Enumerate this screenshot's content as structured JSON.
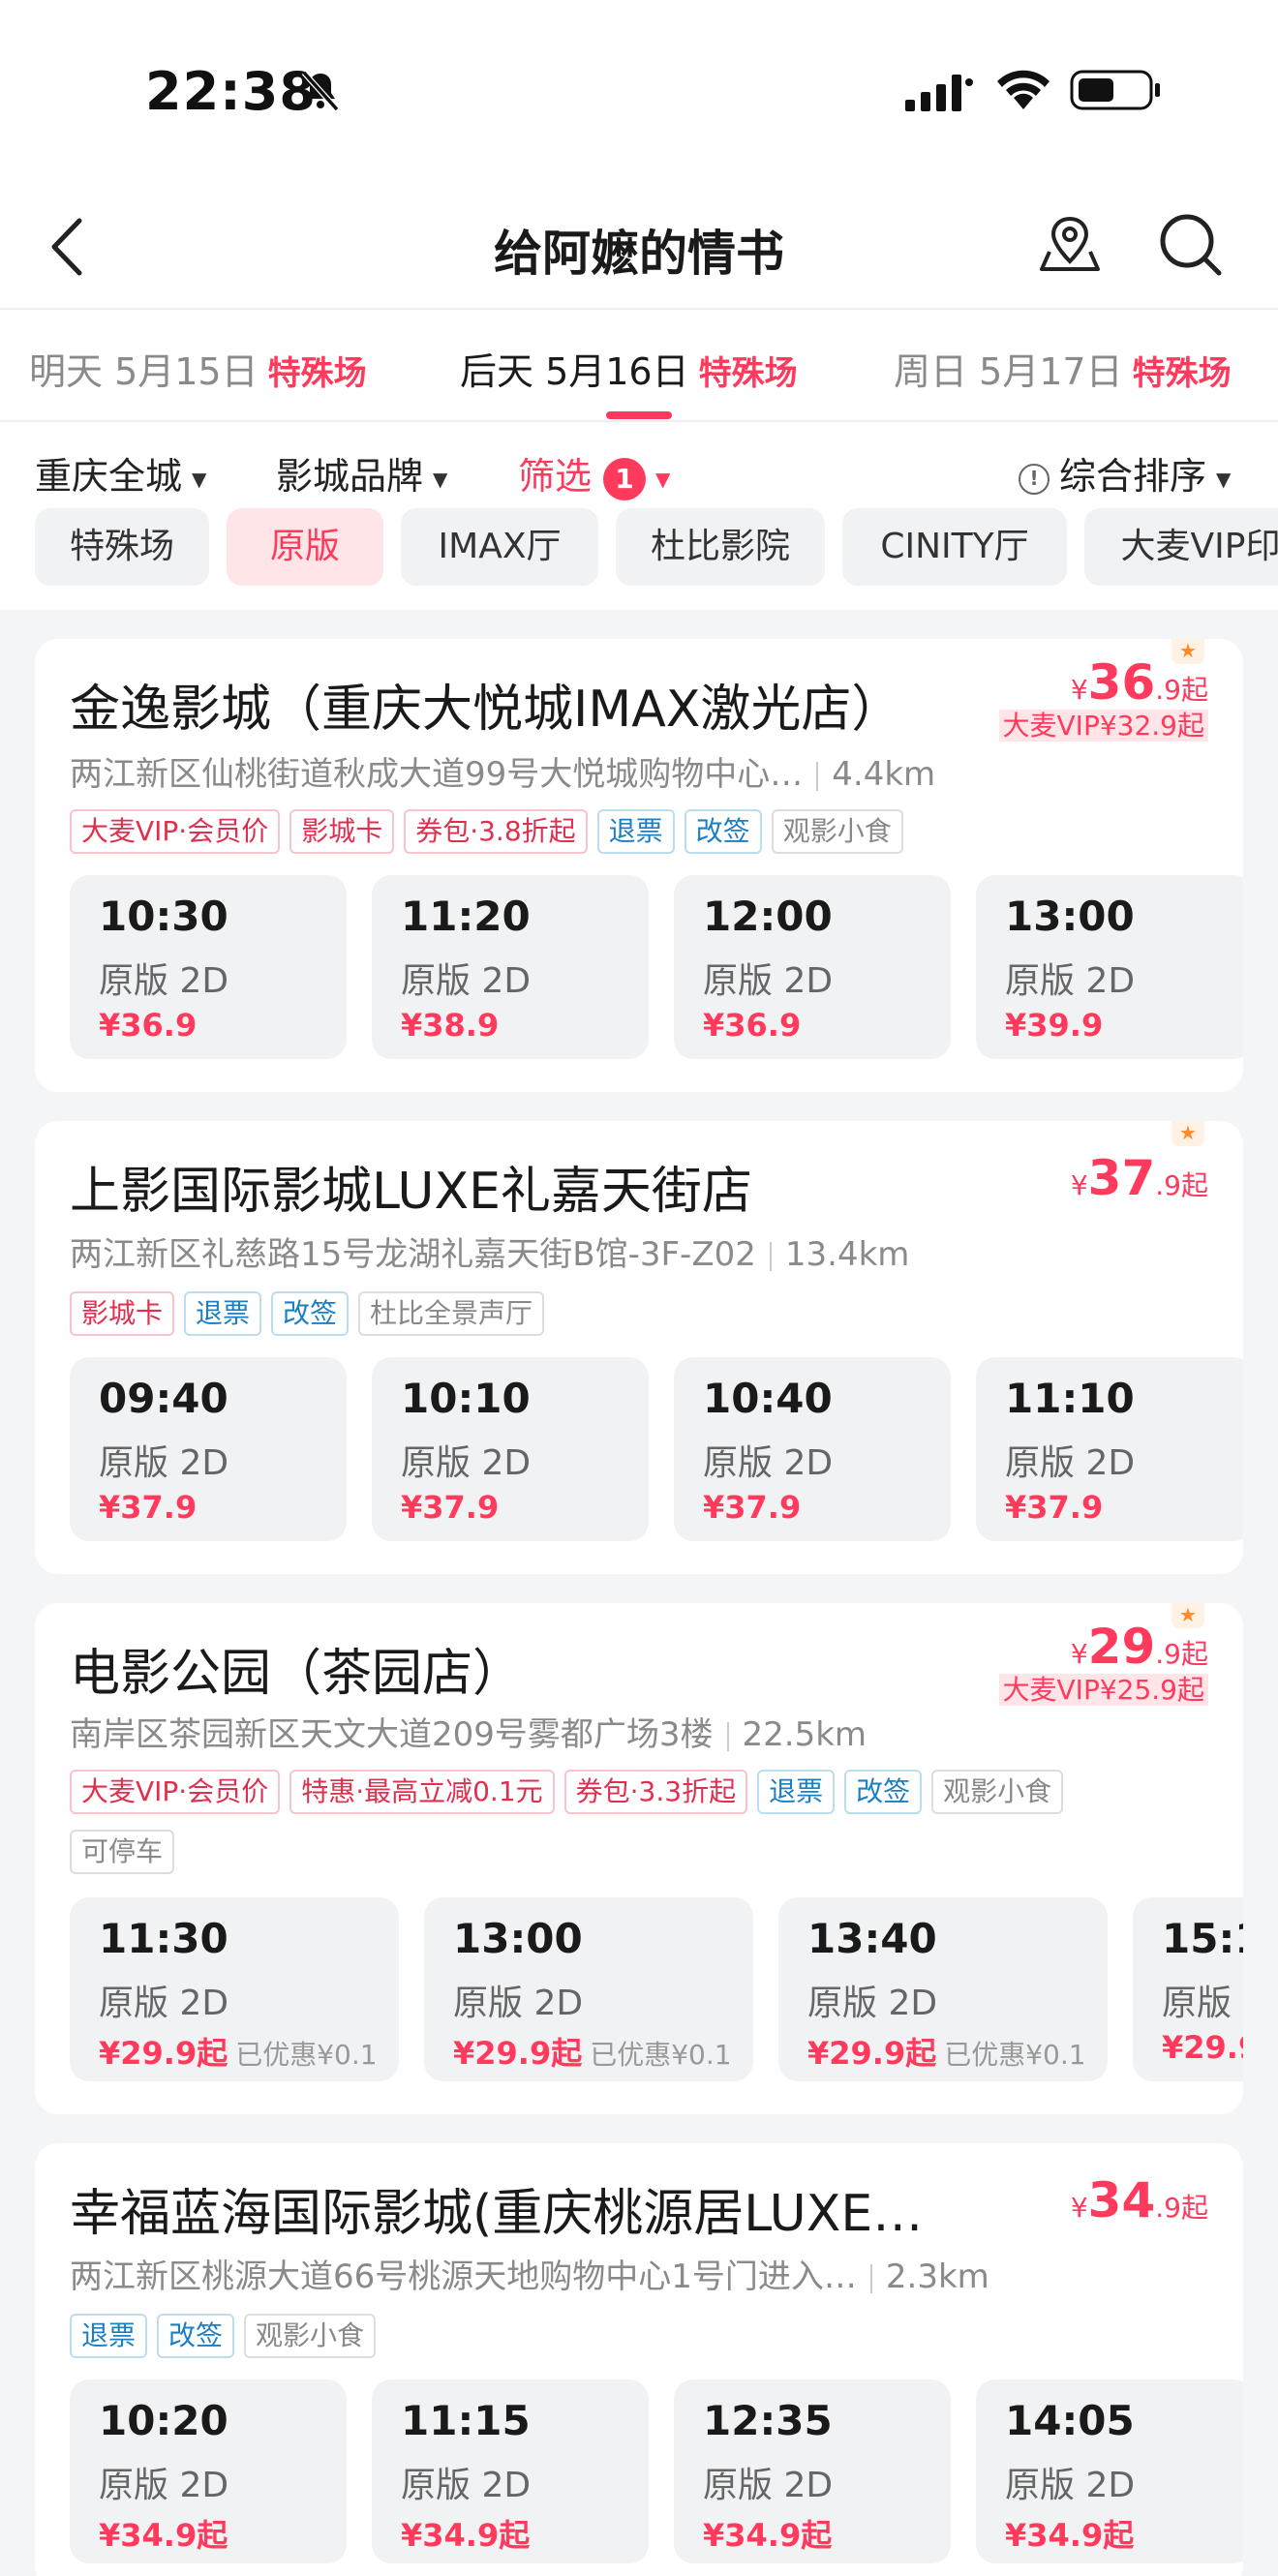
{
  "status": {
    "time": "22:38"
  },
  "nav": {
    "title": "给阿嬷的情书"
  },
  "dates": [
    {
      "label": "明天 5月15日",
      "special": "特殊场"
    },
    {
      "label": "后天 5月16日",
      "special": "特殊场"
    },
    {
      "label": "周日 5月17日",
      "special": "特殊场"
    }
  ],
  "filters": {
    "city": "重庆全城",
    "brand": "影城品牌",
    "screen": "筛选",
    "screen_count": "1",
    "sort": "综合排序"
  },
  "chips": [
    "特殊场",
    "原版",
    "IMAX厅",
    "杜比影院",
    "CINITY厅",
    "大麦VIP印"
  ],
  "cinemas": [
    {
      "name": "金逸影城（重庆大悦城IMAX激光店）",
      "price_int": "36",
      "price_dec": ".9",
      "price_suffix": "起",
      "vip_price": "大麦VIP¥32.9起",
      "address": "两江新区仙桃街道秋成大道99号大悦城购物中心…",
      "distance": "4.4km",
      "tags": [
        {
          "text": "大麦VIP·会员价",
          "color": "red"
        },
        {
          "text": "影城卡",
          "color": "red"
        },
        {
          "text": "券包·3.8折起",
          "color": "red"
        },
        {
          "text": "退票",
          "color": "blue"
        },
        {
          "text": "改签",
          "color": "blue"
        },
        {
          "text": "观影小食",
          "color": "gray"
        }
      ],
      "showtimes": [
        {
          "time": "10:30",
          "version": "原版 2D",
          "price": "¥36.9"
        },
        {
          "time": "11:20",
          "version": "原版 2D",
          "price": "¥38.9"
        },
        {
          "time": "12:00",
          "version": "原版 2D",
          "price": "¥36.9"
        },
        {
          "time": "13:00",
          "version": "原版 2D",
          "price": "¥39.9"
        }
      ]
    },
    {
      "name": "上影国际影城LUXE礼嘉天街店",
      "price_int": "37",
      "price_dec": ".9",
      "price_suffix": "起",
      "address": "两江新区礼慈路15号龙湖礼嘉天街B馆-3F-Z02",
      "distance": "13.4km",
      "tags": [
        {
          "text": "影城卡",
          "color": "red"
        },
        {
          "text": "退票",
          "color": "blue"
        },
        {
          "text": "改签",
          "color": "blue"
        },
        {
          "text": "杜比全景声厅",
          "color": "gray"
        }
      ],
      "showtimes": [
        {
          "time": "09:40",
          "version": "原版 2D",
          "price": "¥37.9"
        },
        {
          "time": "10:10",
          "version": "原版 2D",
          "price": "¥37.9"
        },
        {
          "time": "10:40",
          "version": "原版 2D",
          "price": "¥37.9"
        },
        {
          "time": "11:10",
          "version": "原版 2D",
          "price": "¥37.9"
        }
      ]
    },
    {
      "name": "电影公园（茶园店）",
      "price_int": "29",
      "price_dec": ".9",
      "price_suffix": "起",
      "vip_price": "大麦VIP¥25.9起",
      "address": "南岸区茶园新区天文大道209号雾都广场3楼",
      "distance": "22.5km",
      "tags": [
        {
          "text": "大麦VIP·会员价",
          "color": "red"
        },
        {
          "text": "特惠·最高立减0.1元",
          "color": "red"
        },
        {
          "text": "券包·3.3折起",
          "color": "red"
        },
        {
          "text": "退票",
          "color": "blue"
        },
        {
          "text": "改签",
          "color": "blue"
        },
        {
          "text": "观影小食",
          "color": "gray"
        },
        {
          "text": "可停车",
          "color": "gray"
        }
      ],
      "showtimes": [
        {
          "time": "11:30",
          "version": "原版 2D",
          "price": "¥29.9起",
          "discount": "已优惠¥0.1"
        },
        {
          "time": "13:00",
          "version": "原版 2D",
          "price": "¥29.9起",
          "discount": "已优惠¥0.1"
        },
        {
          "time": "13:40",
          "version": "原版 2D",
          "price": "¥29.9起",
          "discount": "已优惠¥0.1"
        },
        {
          "time": "15:1",
          "version": "原版",
          "price": "¥29.9"
        }
      ]
    },
    {
      "name": "幸福蓝海国际影城(重庆桃源居LUXE…",
      "price_int": "34",
      "price_dec": ".9",
      "price_suffix": "起",
      "address": "两江新区桃源大道66号桃源天地购物中心1号门进入…",
      "distance": "2.3km",
      "tags": [
        {
          "text": "退票",
          "color": "blue"
        },
        {
          "text": "改签",
          "color": "blue"
        },
        {
          "text": "观影小食",
          "color": "gray"
        }
      ],
      "showtimes": [
        {
          "time": "10:20",
          "version": "原版 2D",
          "price": "¥34.9起"
        },
        {
          "time": "11:15",
          "version": "原版 2D",
          "price": "¥34.9起"
        },
        {
          "time": "12:35",
          "version": "原版 2D",
          "price": "¥34.9起"
        },
        {
          "time": "14:05",
          "version": "原版 2D",
          "price": "¥34.9起"
        }
      ]
    }
  ]
}
